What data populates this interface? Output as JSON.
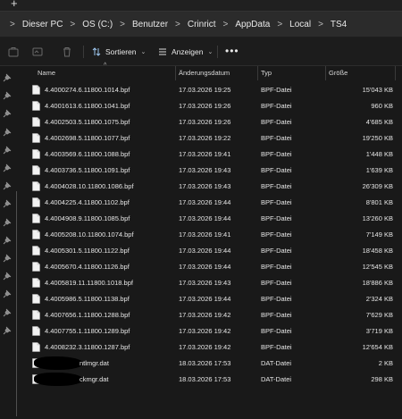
{
  "window": {
    "new_tab_glyph": "+"
  },
  "address_bar": {
    "breadcrumbs": [
      "Dieser PC",
      "OS (C:)",
      "Benutzer",
      "Crinrict",
      "AppData",
      "Local",
      "TS4"
    ],
    "separator_glyph": ">"
  },
  "toolbar": {
    "sort_label": "Sortieren",
    "view_label": "Anzeigen",
    "more_glyph": "•••",
    "icons": [
      "cut-icon",
      "copy-icon",
      "delete-icon",
      "sort-icon",
      "view-icon",
      "more-icon"
    ]
  },
  "columns": {
    "name": "Name",
    "date": "Änderungsdatum",
    "type": "Typ",
    "size": "Größe"
  },
  "files": [
    {
      "name": "4.4000274.6.11800.1014.bpf",
      "date": "17.03.2026 19:25",
      "type": "BPF-Datei",
      "size": "15'043 KB"
    },
    {
      "name": "4.4001613.6.11800.1041.bpf",
      "date": "17.03.2026 19:26",
      "type": "BPF-Datei",
      "size": "960 KB"
    },
    {
      "name": "4.4002503.5.11800.1075.bpf",
      "date": "17.03.2026 19:26",
      "type": "BPF-Datei",
      "size": "4'685 KB"
    },
    {
      "name": "4.4002698.5.11800.1077.bpf",
      "date": "17.03.2026 19:22",
      "type": "BPF-Datei",
      "size": "19'250 KB"
    },
    {
      "name": "4.4003569.6.11800.1088.bpf",
      "date": "17.03.2026 19:41",
      "type": "BPF-Datei",
      "size": "1'448 KB"
    },
    {
      "name": "4.4003736.5.11800.1091.bpf",
      "date": "17.03.2026 19:43",
      "type": "BPF-Datei",
      "size": "1'639 KB"
    },
    {
      "name": "4.4004028.10.11800.1086.bpf",
      "date": "17.03.2026 19:43",
      "type": "BPF-Datei",
      "size": "26'309 KB"
    },
    {
      "name": "4.4004225.4.11800.1102.bpf",
      "date": "17.03.2026 19:44",
      "type": "BPF-Datei",
      "size": "8'801 KB"
    },
    {
      "name": "4.4004908.9.11800.1085.bpf",
      "date": "17.03.2026 19:44",
      "type": "BPF-Datei",
      "size": "13'260 KB"
    },
    {
      "name": "4.4005208.10.11800.1074.bpf",
      "date": "17.03.2026 19:41",
      "type": "BPF-Datei",
      "size": "7'149 KB"
    },
    {
      "name": "4.4005301.5.11800.1122.bpf",
      "date": "17.03.2026 19:44",
      "type": "BPF-Datei",
      "size": "18'458 KB"
    },
    {
      "name": "4.4005670.4.11800.1126.bpf",
      "date": "17.03.2026 19:44",
      "type": "BPF-Datei",
      "size": "12'545 KB"
    },
    {
      "name": "4.4005819.11.11800.1018.bpf",
      "date": "17.03.2026 19:43",
      "type": "BPF-Datei",
      "size": "18'886 KB"
    },
    {
      "name": "4.4005986.5.11800.1138.bpf",
      "date": "17.03.2026 19:44",
      "type": "BPF-Datei",
      "size": "2'324 KB"
    },
    {
      "name": "4.4007656.1.11800.1288.bpf",
      "date": "17.03.2026 19:42",
      "type": "BPF-Datei",
      "size": "7'629 KB"
    },
    {
      "name": "4.4007755.1.11800.1289.bpf",
      "date": "17.03.2026 19:42",
      "type": "BPF-Datei",
      "size": "3'719 KB"
    },
    {
      "name": "4.4008232.3.11800.1287.bpf",
      "date": "17.03.2026 19:42",
      "type": "BPF-Datei",
      "size": "12'654 KB"
    },
    {
      "name": "ntlmgr.dat",
      "date": "18.03.2026 17:53",
      "type": "DAT-Datei",
      "size": "2 KB",
      "redacted": true
    },
    {
      "name": "ckmgr.dat",
      "date": "18.03.2026 17:53",
      "type": "DAT-Datei",
      "size": "298 KB",
      "redacted": true
    }
  ],
  "nav_pins": 15
}
